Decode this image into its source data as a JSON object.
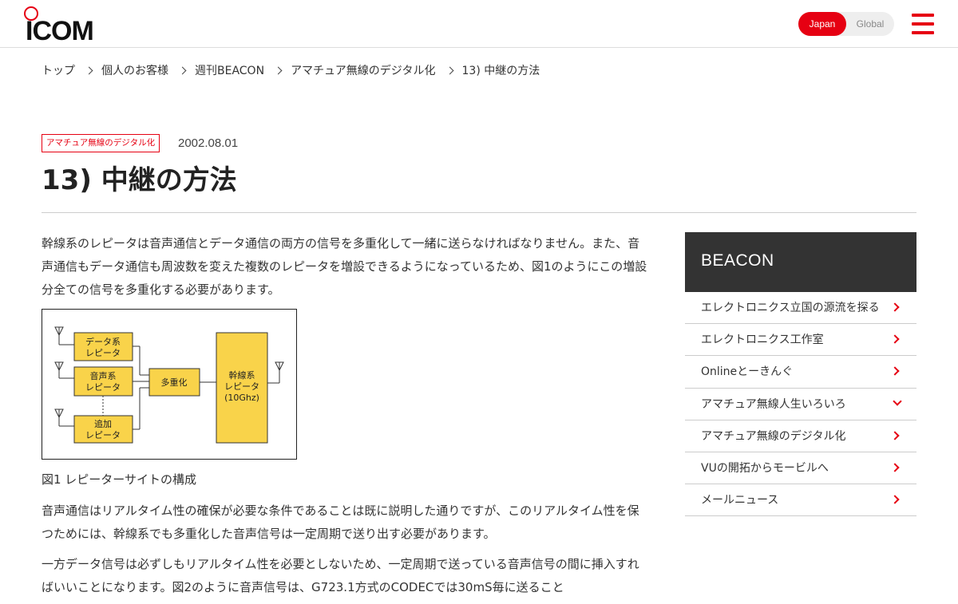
{
  "header": {
    "logo_text": "ICOM",
    "lang": {
      "japan": "Japan",
      "global": "Global"
    },
    "brand_color": "#e60012"
  },
  "breadcrumb": [
    "トップ",
    "個人のお客様",
    "週刊BEACON",
    "アマチュア無線のデジタル化",
    "13) 中継の方法"
  ],
  "article": {
    "category": "アマチュア無線のデジタル化",
    "date": "2002.08.01",
    "title": "13) 中継の方法",
    "paragraphs": [
      "幹線系のレピータは音声通信とデータ通信の両方の信号を多重化して一緒に送らなければなりません。また、音声通信もデータ通信も周波数を変えた複数のレピータを増設できるようになっているため、図1のようにこの増設分全ての信号を多重化する必要があります。",
      "音声通信はリアルタイム性の確保が必要な条件であることは既に説明した通りですが、このリアルタイム性を保つためには、幹線系でも多重化した音声信号は一定周期で送り出す必要があります。",
      "一方データ信号は必ずしもリアルタイム性を必要としないため、一定周期で送っている音声信号の間に挿入すればいいことになります。図2のように音声信号は、G723.1方式のCODECでは30mS毎に送ること"
    ],
    "figure": {
      "caption": "図1 レピーターサイトの構成",
      "labels": {
        "data_repeater": [
          "データ系",
          "レピータ"
        ],
        "voice_repeater": [
          "音声系",
          "レピータ"
        ],
        "added_repeater": [
          "追加",
          "レピータ"
        ],
        "multiplexer": "多重化",
        "trunk_repeater": [
          "幹線系",
          "レピータ",
          "(10Ghz)"
        ]
      }
    }
  },
  "sidebar": {
    "title": "BEACON",
    "items": [
      {
        "label": "エレクトロニクス立国の源流を探る",
        "icon": "chevron-right"
      },
      {
        "label": "エレクトロニクス工作室",
        "icon": "chevron-right"
      },
      {
        "label": "Onlineとーきんぐ",
        "icon": "chevron-right"
      },
      {
        "label": "アマチュア無線人生いろいろ",
        "icon": "chevron-down"
      },
      {
        "label": "アマチュア無線のデジタル化",
        "icon": "chevron-right"
      },
      {
        "label": "VUの開拓からモービルへ",
        "icon": "chevron-right"
      },
      {
        "label": "メールニュース",
        "icon": "chevron-right"
      }
    ]
  }
}
